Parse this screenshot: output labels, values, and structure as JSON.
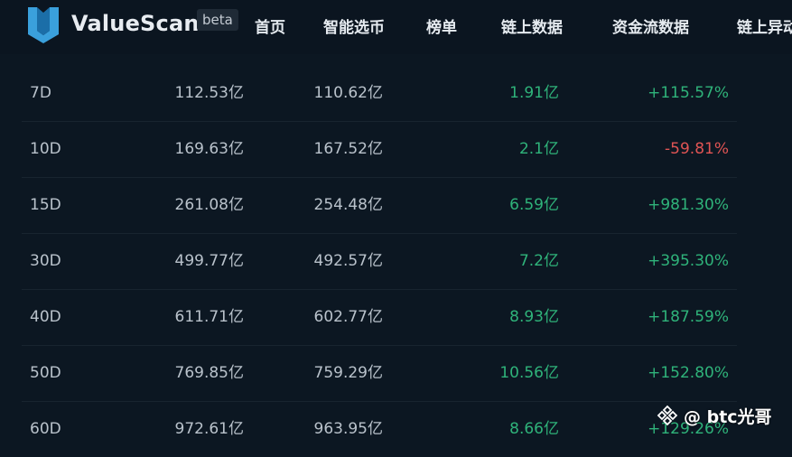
{
  "brand": {
    "name": "ValueScan",
    "badge": "beta"
  },
  "nav": [
    "首页",
    "智能选币",
    "榜单",
    "链上数据",
    "资金流数据",
    "链上异动"
  ],
  "table": {
    "rows": [
      {
        "period": "7D",
        "a": "112.53亿",
        "b": "110.62亿",
        "flow": "1.91亿",
        "pct": "+115.57%",
        "trend": "up"
      },
      {
        "period": "10D",
        "a": "169.63亿",
        "b": "167.52亿",
        "flow": "2.1亿",
        "pct": "-59.81%",
        "trend": "down"
      },
      {
        "period": "15D",
        "a": "261.08亿",
        "b": "254.48亿",
        "flow": "6.59亿",
        "pct": "+981.30%",
        "trend": "up"
      },
      {
        "period": "30D",
        "a": "499.77亿",
        "b": "492.57亿",
        "flow": "7.2亿",
        "pct": "+395.30%",
        "trend": "up"
      },
      {
        "period": "40D",
        "a": "611.71亿",
        "b": "602.77亿",
        "flow": "8.93亿",
        "pct": "+187.59%",
        "trend": "up"
      },
      {
        "period": "50D",
        "a": "769.85亿",
        "b": "759.29亿",
        "flow": "10.56亿",
        "pct": "+152.80%",
        "trend": "up"
      },
      {
        "period": "60D",
        "a": "972.61亿",
        "b": "963.95亿",
        "flow": "8.66亿",
        "pct": "+129.26%",
        "trend": "up"
      }
    ]
  },
  "watermark": {
    "text": "@ btc光哥",
    "icon": "binance-diamond-icon"
  },
  "colors": {
    "positive": "#2fb37a",
    "negative": "#e05454",
    "background": "#0c1722",
    "logo": "#3aa0dc"
  }
}
